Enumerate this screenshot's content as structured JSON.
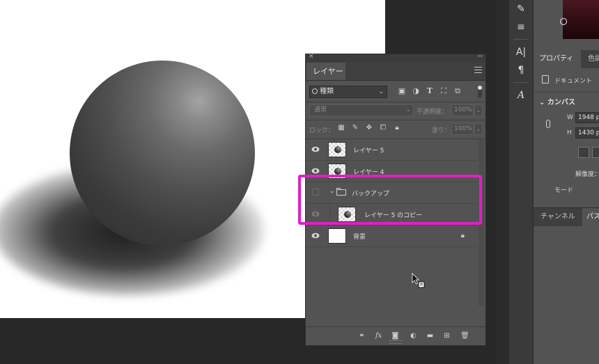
{
  "layers_panel": {
    "close_glyph": "×",
    "collapse_glyph": "‹‹",
    "tab_label": "レイヤー",
    "filter": {
      "kind_label": "種類",
      "icons": [
        "image-filter-icon",
        "adjustment-filter-icon",
        "type-filter-icon",
        "shape-filter-icon",
        "smart-object-filter-icon"
      ]
    },
    "blend": {
      "mode": "通常",
      "opacity_label": "不透明度：",
      "opacity_value": "100%"
    },
    "lock": {
      "label": "ロック：",
      "fill_label": "塗り：",
      "fill_value": "100%"
    },
    "layers": [
      {
        "name": "レイヤー 5",
        "visible": true,
        "type": "pixel"
      },
      {
        "name": "レイヤー 4",
        "visible": true,
        "type": "pixel"
      },
      {
        "name": "バックアップ",
        "visible": false,
        "type": "group",
        "expanded": true
      },
      {
        "name": "レイヤー 5 のコピー",
        "visible": true,
        "type": "pixel",
        "in_group": true
      },
      {
        "name": "背景",
        "visible": true,
        "type": "background",
        "locked": true
      }
    ],
    "footer_icons": [
      "link-icon",
      "fx-icon",
      "mask-icon",
      "adjustment-layer-icon",
      "new-group-icon",
      "new-layer-icon",
      "trash-icon"
    ],
    "fx_label": "fx"
  },
  "properties_panel": {
    "tabs": [
      "プロパティ",
      "色調"
    ],
    "doc_label": "ドキュメント",
    "canvas_header": "カンバス",
    "width_label": "W",
    "width_value": "1948 p",
    "height_label": "H",
    "height_value": "1430 p",
    "resolution_label": "解像度：",
    "mode_label": "モード"
  },
  "bottom_tabs": [
    "チャンネル",
    "パス"
  ],
  "colors": {
    "highlight": "#e21fc7",
    "panel_bg": "#535353",
    "workspace_bg": "#282828"
  }
}
